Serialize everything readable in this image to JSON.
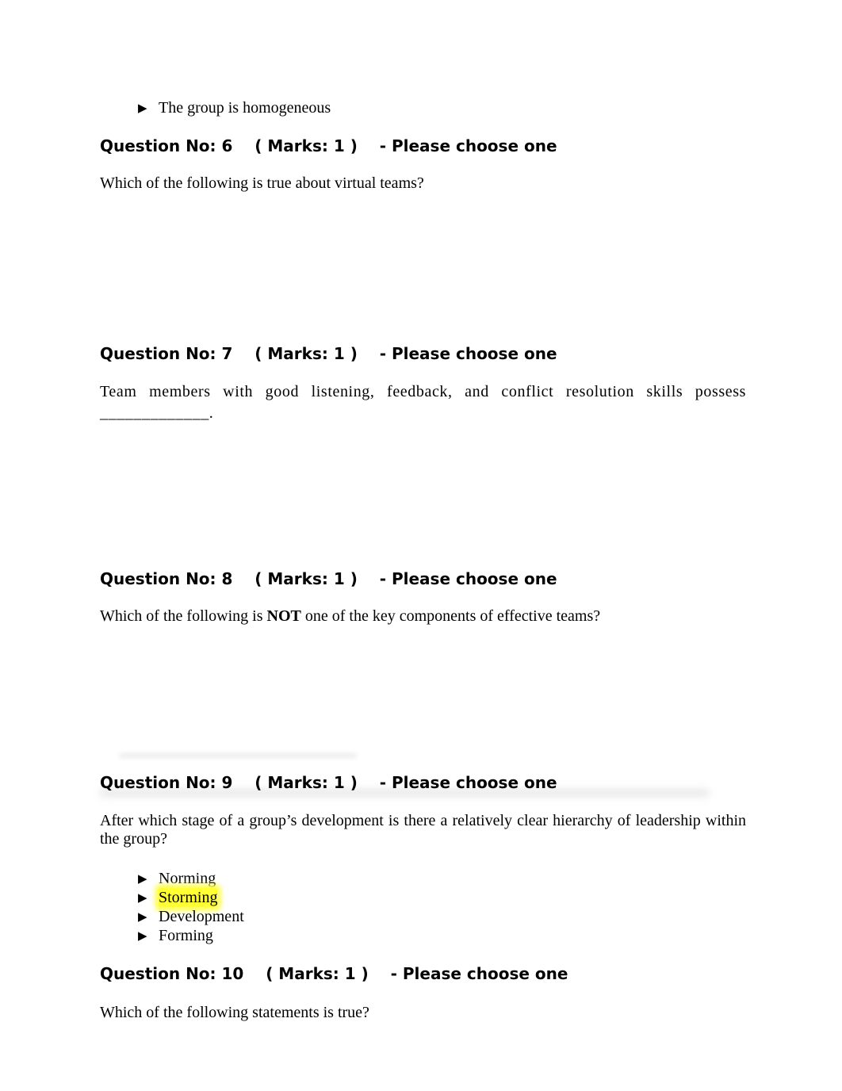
{
  "document": {
    "prev_question_tail": {
      "options": [
        {
          "bullet": "▶",
          "text": "The group is homogeneous"
        }
      ]
    },
    "questions": [
      {
        "header": {
          "number_label": "Question No: 6",
          "marks_label": "( Marks: 1 )",
          "instruction": "- Please choose one"
        },
        "text": "Which of the following is true about virtual teams?"
      },
      {
        "header": {
          "number_label": "Question No: 7",
          "marks_label": "( Marks: 1 )",
          "instruction": "- Please choose one"
        },
        "text": "Team members with good listening, feedback, and conflict resolution skills possess _____________."
      },
      {
        "header": {
          "number_label": "Question No: 8",
          "marks_label": "( Marks: 1 )",
          "instruction": "- Please choose one"
        },
        "text_before": "Which of the following is ",
        "text_emphasis": "NOT",
        "text_after": " one of the key components of effective teams?"
      },
      {
        "header": {
          "number_label": "Question No: 9",
          "marks_label": "( Marks: 1 )",
          "instruction": "- Please choose one"
        },
        "text": "After which stage of a group’s development is there a relatively clear hierarchy of leadership within the group?",
        "options": [
          {
            "bullet": "▶",
            "text": "Norming",
            "highlighted": false
          },
          {
            "bullet": "▶",
            "text": "Storming",
            "highlighted": true
          },
          {
            "bullet": "▶",
            "text": "Development",
            "highlighted": false
          },
          {
            "bullet": "▶",
            "text": "Forming",
            "highlighted": false
          }
        ]
      },
      {
        "header": {
          "number_label": "Question No: 10",
          "marks_label": "( Marks: 1 )",
          "instruction": "- Please choose one"
        },
        "text": "Which of the following statements is true?"
      }
    ],
    "colors": {
      "highlight": "#ffff33",
      "text": "#000000",
      "background": "#ffffff"
    }
  }
}
